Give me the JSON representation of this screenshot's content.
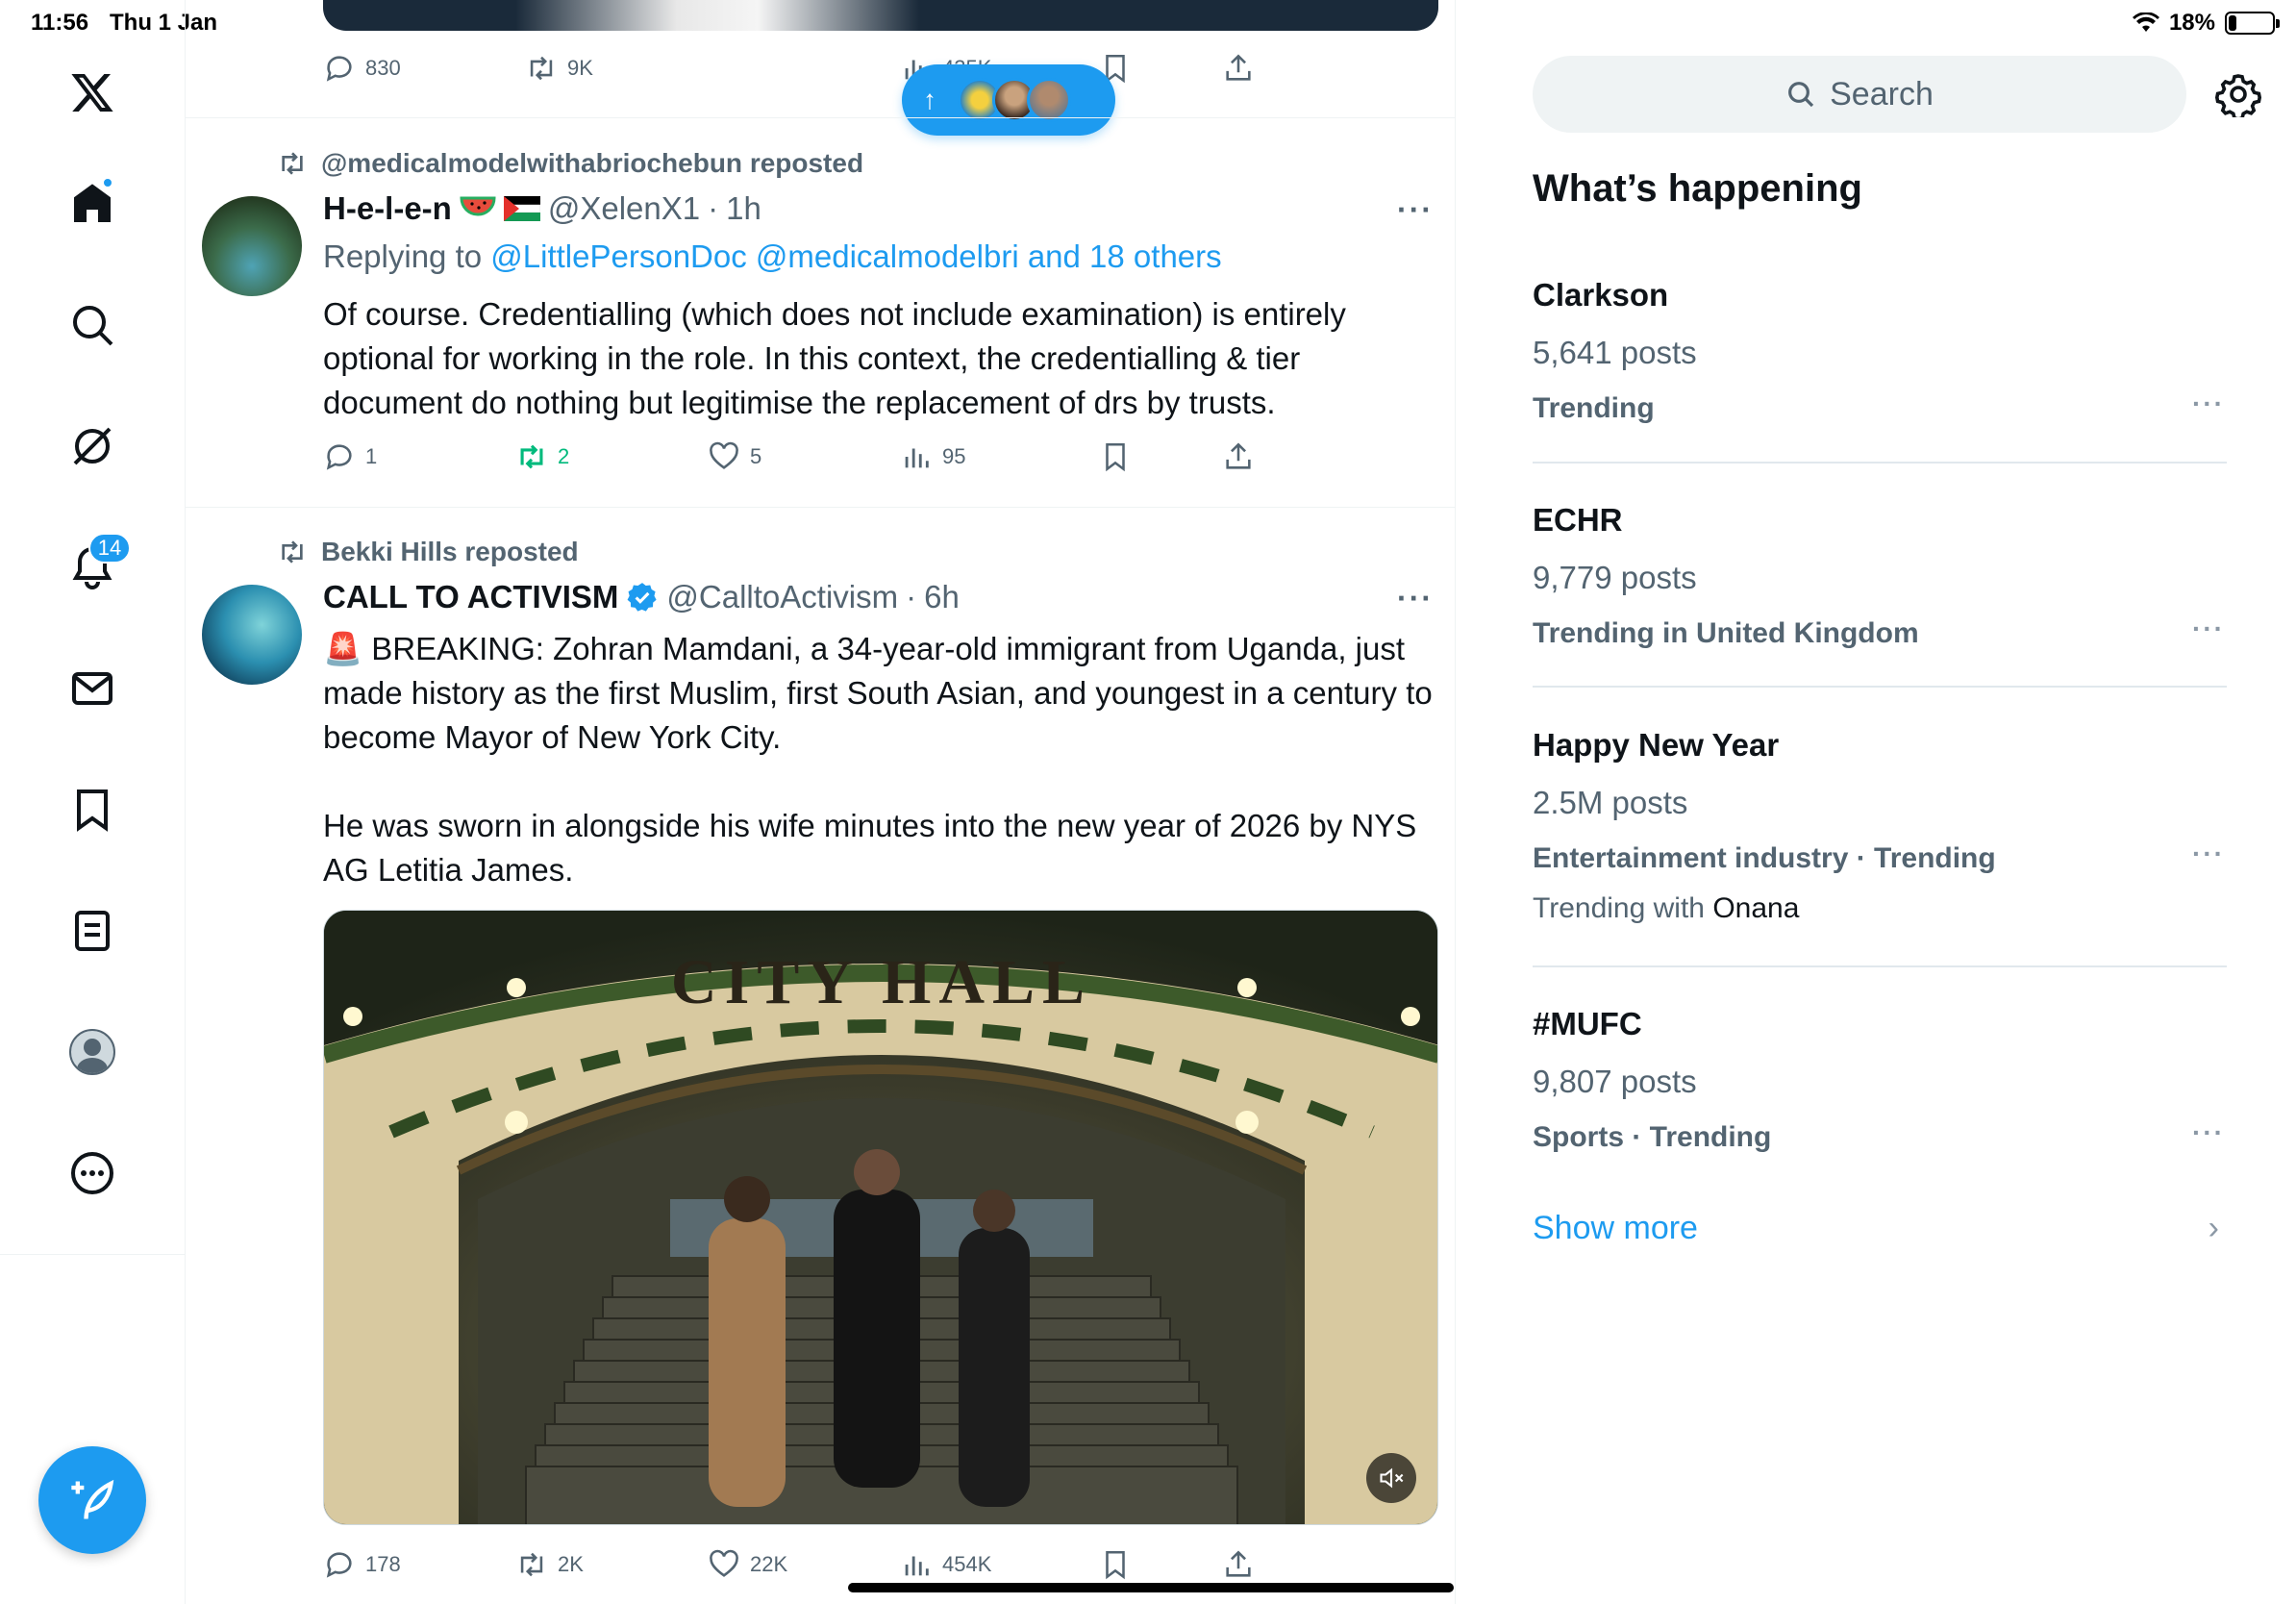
{
  "status_bar": {
    "time": "11:56",
    "date": "Thu 1 Jan",
    "battery": "18%",
    "battery_level": 0.18
  },
  "nav": {
    "notifications_badge": "14"
  },
  "pill_new_posts": {
    "arrow": "↑"
  },
  "top_tweet_actions": {
    "replies": "830",
    "reposts": "9K",
    "views": "435K"
  },
  "tweet1": {
    "repost_by": "@medicalmodelwithabriochebun reposted",
    "name": "H-e-l-e-n",
    "handle": "@XelenX1",
    "separator": "·",
    "time": "1h",
    "reply_prefix": "Replying to",
    "reply_targets": "@LittlePersonDoc @medicalmodelbri and 18 others",
    "text": "Of course. Credentialling (which does not include examination) is entirely optional for working in the role. In this context, the credentialling & tier document do nothing but legitimise the replacement of drs by trusts.",
    "replies": "1",
    "reposts": "2",
    "likes": "5",
    "views": "95",
    "more": "···"
  },
  "tweet2": {
    "repost_by": "Bekki Hills reposted",
    "name": "CALL TO ACTIVISM",
    "handle": "@CalltoActivism",
    "separator": "·",
    "time": "6h",
    "text_p1": "🚨 BREAKING: Zohran Mamdani, a 34-year-old immigrant from Uganda, just made history as the first Muslim, first South Asian, and youngest in a century to become Mayor of New York City.",
    "text_p2": "He was sworn in alongside his wife minutes into the new year of 2026 by NYS AG Letitia James.",
    "video_sign": "CITY HALL",
    "replies": "178",
    "reposts": "2K",
    "likes": "22K",
    "views": "454K",
    "more": "···"
  },
  "sidebar": {
    "search_placeholder": "Search",
    "section_title": "What’s happening",
    "trends": [
      {
        "name": "Clarkson",
        "count": "5,641 posts",
        "meta": "Trending",
        "with": ""
      },
      {
        "name": "ECHR",
        "count": "9,779 posts",
        "meta": "Trending in United Kingdom",
        "with": ""
      },
      {
        "name": "Happy New Year",
        "count": "2.5M posts",
        "meta": "Entertainment industry · Trending",
        "with_prefix": "Trending with",
        "with": "Onana"
      },
      {
        "name": "#MUFC",
        "count": "9,807 posts",
        "meta": "Sports · Trending",
        "with": ""
      }
    ],
    "more": "···",
    "show_more": "Show more",
    "chevron": "›"
  },
  "colors": {
    "accent": "#1d9bf0",
    "repost_green": "#00ba7c",
    "text_secondary": "#536471"
  }
}
